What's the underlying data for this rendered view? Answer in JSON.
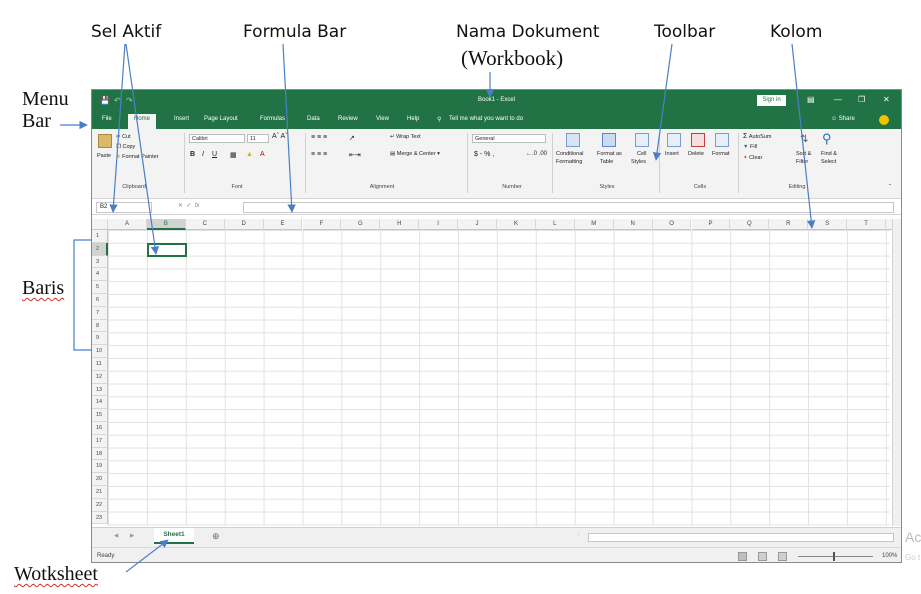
{
  "annotations": {
    "sel_aktif": "Sel Aktif",
    "formula_bar": "Formula Bar",
    "nama_dokument_line1": "Nama Dokument",
    "nama_dokument_line2": "(Workbook)",
    "toolbar": "Toolbar",
    "kolom": "Kolom",
    "menu_bar_line1": "Menu",
    "menu_bar_line2": "Bar",
    "baris": "Baris",
    "worksheet": "Wotksheet"
  },
  "excel": {
    "title": "Book1 - Excel",
    "sign_in": "Sign in",
    "share": "Share",
    "tabs": [
      "File",
      "Home",
      "Insert",
      "Page Layout",
      "Formulas",
      "Data",
      "Review",
      "View",
      "Help"
    ],
    "tell_me": "Tell me what you want to do",
    "ribbon": {
      "paste": "Paste",
      "cut": "Cut",
      "copy": "Copy",
      "format_painter": "Format Painter",
      "clipboard": "Clipboard",
      "font_name": "Calibri",
      "font_size": "11",
      "font_group": "Font",
      "wrap_text": "Wrap Text",
      "merge_center": "Merge & Center",
      "alignment": "Alignment",
      "number_format": "General",
      "number_symbols": "$ - % ,",
      "number": "Number",
      "conditional_formatting_1": "Conditional",
      "conditional_formatting_2": "Formatting",
      "format_as_table_1": "Format as",
      "format_as_table_2": "Table",
      "cell_styles_1": "Cell",
      "cell_styles_2": "Styles",
      "styles": "Styles",
      "insert": "Insert",
      "delete": "Delete",
      "format": "Format",
      "cells": "Cells",
      "autosum": "AutoSum",
      "fill": "Fill",
      "clear": "Clear",
      "sort_filter_1": "Sort &",
      "sort_filter_2": "Filter",
      "find_select_1": "Find &",
      "find_select_2": "Select",
      "editing": "Editing"
    },
    "name_box": "B2",
    "fx": "fx",
    "columns": [
      "A",
      "B",
      "C",
      "D",
      "E",
      "F",
      "G",
      "H",
      "I",
      "J",
      "K",
      "L",
      "M",
      "N",
      "O",
      "P",
      "Q",
      "R",
      "S",
      "T",
      "U"
    ],
    "rows": [
      "1",
      "2",
      "3",
      "4",
      "5",
      "6",
      "7",
      "8",
      "9",
      "10",
      "11",
      "12",
      "13",
      "14",
      "15",
      "16",
      "17",
      "18",
      "19",
      "20",
      "21",
      "22",
      "23"
    ],
    "sheet_tab": "Sheet1",
    "status": "Ready",
    "zoom": "100%"
  },
  "watermark": {
    "line1": "Act",
    "line2": "Go t"
  }
}
